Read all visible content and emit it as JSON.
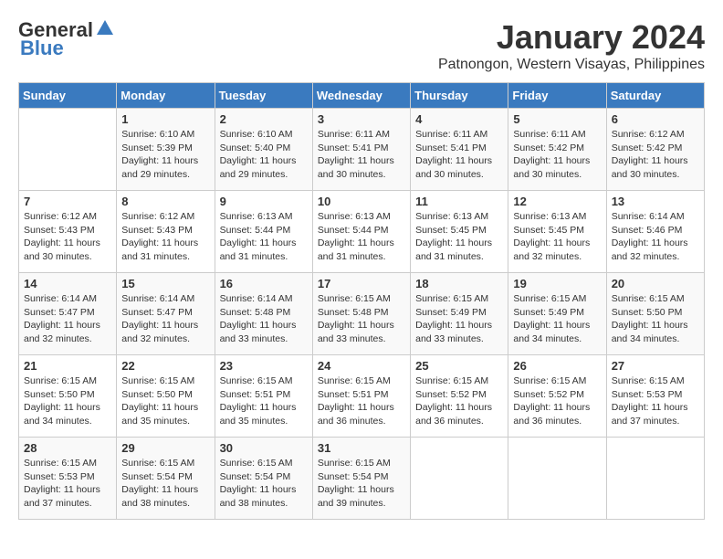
{
  "logo": {
    "general": "General",
    "blue": "Blue"
  },
  "title": "January 2024",
  "location": "Patnongon, Western Visayas, Philippines",
  "days_header": [
    "Sunday",
    "Monday",
    "Tuesday",
    "Wednesday",
    "Thursday",
    "Friday",
    "Saturday"
  ],
  "weeks": [
    [
      {
        "day": "",
        "sunrise": "",
        "sunset": "",
        "daylight": ""
      },
      {
        "day": "1",
        "sunrise": "Sunrise: 6:10 AM",
        "sunset": "Sunset: 5:39 PM",
        "daylight": "Daylight: 11 hours and 29 minutes."
      },
      {
        "day": "2",
        "sunrise": "Sunrise: 6:10 AM",
        "sunset": "Sunset: 5:40 PM",
        "daylight": "Daylight: 11 hours and 29 minutes."
      },
      {
        "day": "3",
        "sunrise": "Sunrise: 6:11 AM",
        "sunset": "Sunset: 5:41 PM",
        "daylight": "Daylight: 11 hours and 30 minutes."
      },
      {
        "day": "4",
        "sunrise": "Sunrise: 6:11 AM",
        "sunset": "Sunset: 5:41 PM",
        "daylight": "Daylight: 11 hours and 30 minutes."
      },
      {
        "day": "5",
        "sunrise": "Sunrise: 6:11 AM",
        "sunset": "Sunset: 5:42 PM",
        "daylight": "Daylight: 11 hours and 30 minutes."
      },
      {
        "day": "6",
        "sunrise": "Sunrise: 6:12 AM",
        "sunset": "Sunset: 5:42 PM",
        "daylight": "Daylight: 11 hours and 30 minutes."
      }
    ],
    [
      {
        "day": "7",
        "sunrise": "Sunrise: 6:12 AM",
        "sunset": "Sunset: 5:43 PM",
        "daylight": "Daylight: 11 hours and 30 minutes."
      },
      {
        "day": "8",
        "sunrise": "Sunrise: 6:12 AM",
        "sunset": "Sunset: 5:43 PM",
        "daylight": "Daylight: 11 hours and 31 minutes."
      },
      {
        "day": "9",
        "sunrise": "Sunrise: 6:13 AM",
        "sunset": "Sunset: 5:44 PM",
        "daylight": "Daylight: 11 hours and 31 minutes."
      },
      {
        "day": "10",
        "sunrise": "Sunrise: 6:13 AM",
        "sunset": "Sunset: 5:44 PM",
        "daylight": "Daylight: 11 hours and 31 minutes."
      },
      {
        "day": "11",
        "sunrise": "Sunrise: 6:13 AM",
        "sunset": "Sunset: 5:45 PM",
        "daylight": "Daylight: 11 hours and 31 minutes."
      },
      {
        "day": "12",
        "sunrise": "Sunrise: 6:13 AM",
        "sunset": "Sunset: 5:45 PM",
        "daylight": "Daylight: 11 hours and 32 minutes."
      },
      {
        "day": "13",
        "sunrise": "Sunrise: 6:14 AM",
        "sunset": "Sunset: 5:46 PM",
        "daylight": "Daylight: 11 hours and 32 minutes."
      }
    ],
    [
      {
        "day": "14",
        "sunrise": "Sunrise: 6:14 AM",
        "sunset": "Sunset: 5:47 PM",
        "daylight": "Daylight: 11 hours and 32 minutes."
      },
      {
        "day": "15",
        "sunrise": "Sunrise: 6:14 AM",
        "sunset": "Sunset: 5:47 PM",
        "daylight": "Daylight: 11 hours and 32 minutes."
      },
      {
        "day": "16",
        "sunrise": "Sunrise: 6:14 AM",
        "sunset": "Sunset: 5:48 PM",
        "daylight": "Daylight: 11 hours and 33 minutes."
      },
      {
        "day": "17",
        "sunrise": "Sunrise: 6:15 AM",
        "sunset": "Sunset: 5:48 PM",
        "daylight": "Daylight: 11 hours and 33 minutes."
      },
      {
        "day": "18",
        "sunrise": "Sunrise: 6:15 AM",
        "sunset": "Sunset: 5:49 PM",
        "daylight": "Daylight: 11 hours and 33 minutes."
      },
      {
        "day": "19",
        "sunrise": "Sunrise: 6:15 AM",
        "sunset": "Sunset: 5:49 PM",
        "daylight": "Daylight: 11 hours and 34 minutes."
      },
      {
        "day": "20",
        "sunrise": "Sunrise: 6:15 AM",
        "sunset": "Sunset: 5:50 PM",
        "daylight": "Daylight: 11 hours and 34 minutes."
      }
    ],
    [
      {
        "day": "21",
        "sunrise": "Sunrise: 6:15 AM",
        "sunset": "Sunset: 5:50 PM",
        "daylight": "Daylight: 11 hours and 34 minutes."
      },
      {
        "day": "22",
        "sunrise": "Sunrise: 6:15 AM",
        "sunset": "Sunset: 5:50 PM",
        "daylight": "Daylight: 11 hours and 35 minutes."
      },
      {
        "day": "23",
        "sunrise": "Sunrise: 6:15 AM",
        "sunset": "Sunset: 5:51 PM",
        "daylight": "Daylight: 11 hours and 35 minutes."
      },
      {
        "day": "24",
        "sunrise": "Sunrise: 6:15 AM",
        "sunset": "Sunset: 5:51 PM",
        "daylight": "Daylight: 11 hours and 36 minutes."
      },
      {
        "day": "25",
        "sunrise": "Sunrise: 6:15 AM",
        "sunset": "Sunset: 5:52 PM",
        "daylight": "Daylight: 11 hours and 36 minutes."
      },
      {
        "day": "26",
        "sunrise": "Sunrise: 6:15 AM",
        "sunset": "Sunset: 5:52 PM",
        "daylight": "Daylight: 11 hours and 36 minutes."
      },
      {
        "day": "27",
        "sunrise": "Sunrise: 6:15 AM",
        "sunset": "Sunset: 5:53 PM",
        "daylight": "Daylight: 11 hours and 37 minutes."
      }
    ],
    [
      {
        "day": "28",
        "sunrise": "Sunrise: 6:15 AM",
        "sunset": "Sunset: 5:53 PM",
        "daylight": "Daylight: 11 hours and 37 minutes."
      },
      {
        "day": "29",
        "sunrise": "Sunrise: 6:15 AM",
        "sunset": "Sunset: 5:54 PM",
        "daylight": "Daylight: 11 hours and 38 minutes."
      },
      {
        "day": "30",
        "sunrise": "Sunrise: 6:15 AM",
        "sunset": "Sunset: 5:54 PM",
        "daylight": "Daylight: 11 hours and 38 minutes."
      },
      {
        "day": "31",
        "sunrise": "Sunrise: 6:15 AM",
        "sunset": "Sunset: 5:54 PM",
        "daylight": "Daylight: 11 hours and 39 minutes."
      },
      {
        "day": "",
        "sunrise": "",
        "sunset": "",
        "daylight": ""
      },
      {
        "day": "",
        "sunrise": "",
        "sunset": "",
        "daylight": ""
      },
      {
        "day": "",
        "sunrise": "",
        "sunset": "",
        "daylight": ""
      }
    ]
  ]
}
